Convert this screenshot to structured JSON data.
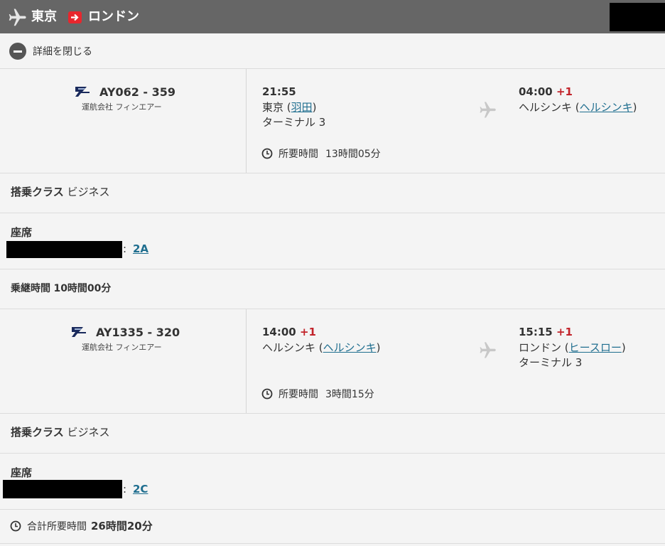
{
  "header": {
    "from": "東京",
    "to": "ロンドン",
    "plane_icon": "airplane-icon",
    "arrow_icon": "arrow-right-icon"
  },
  "details_toggle": {
    "label": "詳細を閉じる",
    "icon": "minus-circle-icon"
  },
  "segments": [
    {
      "flight_no": "AY062 - 359",
      "operator": "運航会社 フィンエアー",
      "dep_time": "21:55",
      "dep_plus": "",
      "dep_city": "東京",
      "dep_airport": "羽田",
      "dep_terminal": "ターミナル 3",
      "arr_time": "04:00",
      "arr_plus": "+1",
      "arr_city": "ヘルシンキ",
      "arr_airport": "ヘルシンキ",
      "arr_terminal": "",
      "duration_label": "所要時間",
      "duration": "13時間05分",
      "class_label": "搭乗クラス",
      "class_value": "ビジネス",
      "seat_label": "座席",
      "seat_sep": ":",
      "seat": "2A"
    },
    {
      "flight_no": "AY1335 - 320",
      "operator": "運航会社 フィンエアー",
      "dep_time": "14:00",
      "dep_plus": "+1",
      "dep_city": "ヘルシンキ",
      "dep_airport": "ヘルシンキ",
      "dep_terminal": "",
      "arr_time": "15:15",
      "arr_plus": "+1",
      "arr_city": "ロンドン",
      "arr_airport": "ヒースロー",
      "arr_terminal": "ターミナル 3",
      "duration_label": "所要時間",
      "duration": "3時間15分",
      "class_label": "搭乗クラス",
      "class_value": "ビジネス",
      "seat_label": "座席",
      "seat_sep": ":",
      "seat": "2C"
    }
  ],
  "layover": {
    "label": "乗継時間",
    "value": "10時間00分"
  },
  "total": {
    "label": "合計所要時間",
    "value": "26時間20分"
  },
  "colors": {
    "header_bg": "#666666",
    "accent_red": "#e8262d",
    "link": "#1f6e8f",
    "plus_red": "#c2232a"
  }
}
